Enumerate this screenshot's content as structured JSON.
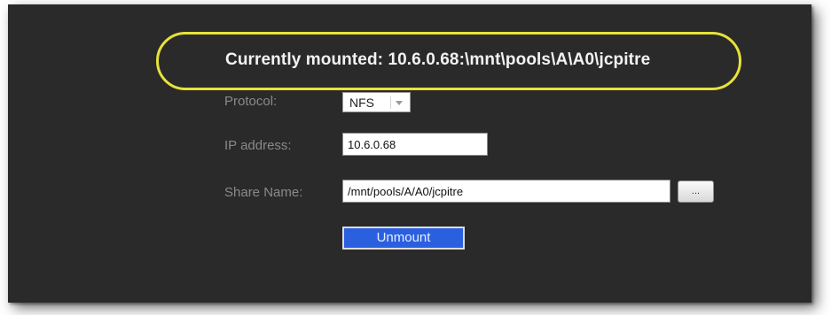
{
  "mount_status": {
    "text": "Currently mounted: 10.6.0.68:\\mnt\\pools\\A\\A0\\jcpitre"
  },
  "form": {
    "protocol": {
      "label": "Protocol:",
      "selected": "NFS"
    },
    "ip_address": {
      "label": "IP address:",
      "value": "10.6.0.68"
    },
    "share_name": {
      "label": "Share Name:",
      "value": "/mnt/pools/A/A0/jcpitre",
      "browse_label": "..."
    },
    "unmount_label": "Unmount"
  },
  "colors": {
    "panel_background": "#2a2a2a",
    "highlight_outline": "#e6e23a",
    "label_text": "#8a8a8a",
    "primary_button": "#2a5fe0"
  },
  "icons": {
    "dropdown": "chevron-down-icon"
  }
}
